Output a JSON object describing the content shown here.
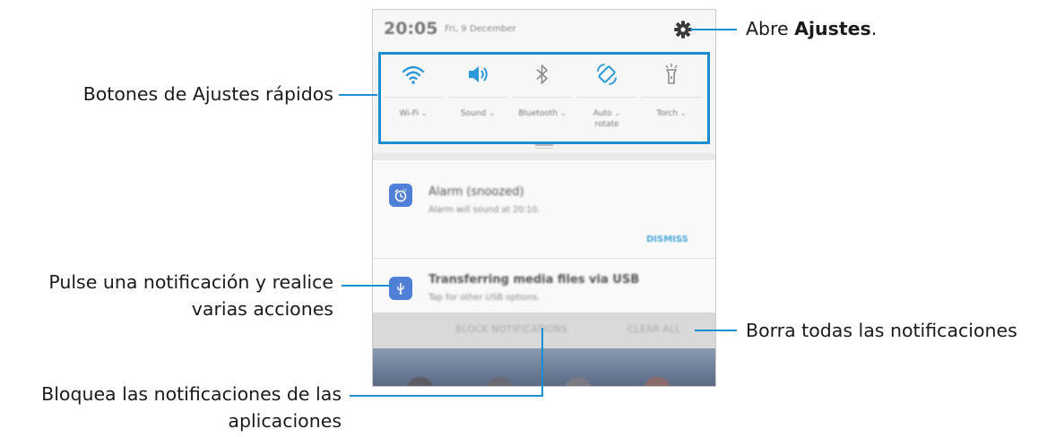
{
  "callouts": {
    "settings_prefix": "Abre ",
    "settings_bold": "Ajustes",
    "settings_suffix": ".",
    "quick_settings": "Botones de Ajustes rápidos",
    "notification_line1": "Pulse una notificación y realice",
    "notification_line2": "varias acciones",
    "clear_all": "Borra todas las notificaciones",
    "block_line1": "Bloquea las notificaciones de las",
    "block_line2": "aplicaciones"
  },
  "accent_color": "#1a8ed0",
  "phone": {
    "status_bar": {
      "time": "20:05",
      "date": "Fri, 9 December",
      "settings_icon": "gear-icon"
    },
    "quick_settings": [
      {
        "icon": "wifi-icon",
        "label": "Wi-Fi"
      },
      {
        "icon": "sound-icon",
        "label": "Sound"
      },
      {
        "icon": "bluetooth-icon",
        "label": "Bluetooth"
      },
      {
        "icon": "auto-rotate-icon",
        "label_line1": "Auto",
        "label_line2": "rotate"
      },
      {
        "icon": "torch-icon",
        "label": "Torch"
      }
    ],
    "notifications": [
      {
        "icon": "alarm-icon",
        "title": "Alarm (snoozed)",
        "subtitle": "Alarm will sound at 20:10.",
        "action": "DISMISS"
      },
      {
        "icon": "usb-icon",
        "title": "Transferring media files via USB",
        "subtitle": "Tap for other USB options."
      }
    ],
    "actions": {
      "block": "BLOCK NOTIFICATIONS",
      "clear": "CLEAR ALL"
    }
  }
}
